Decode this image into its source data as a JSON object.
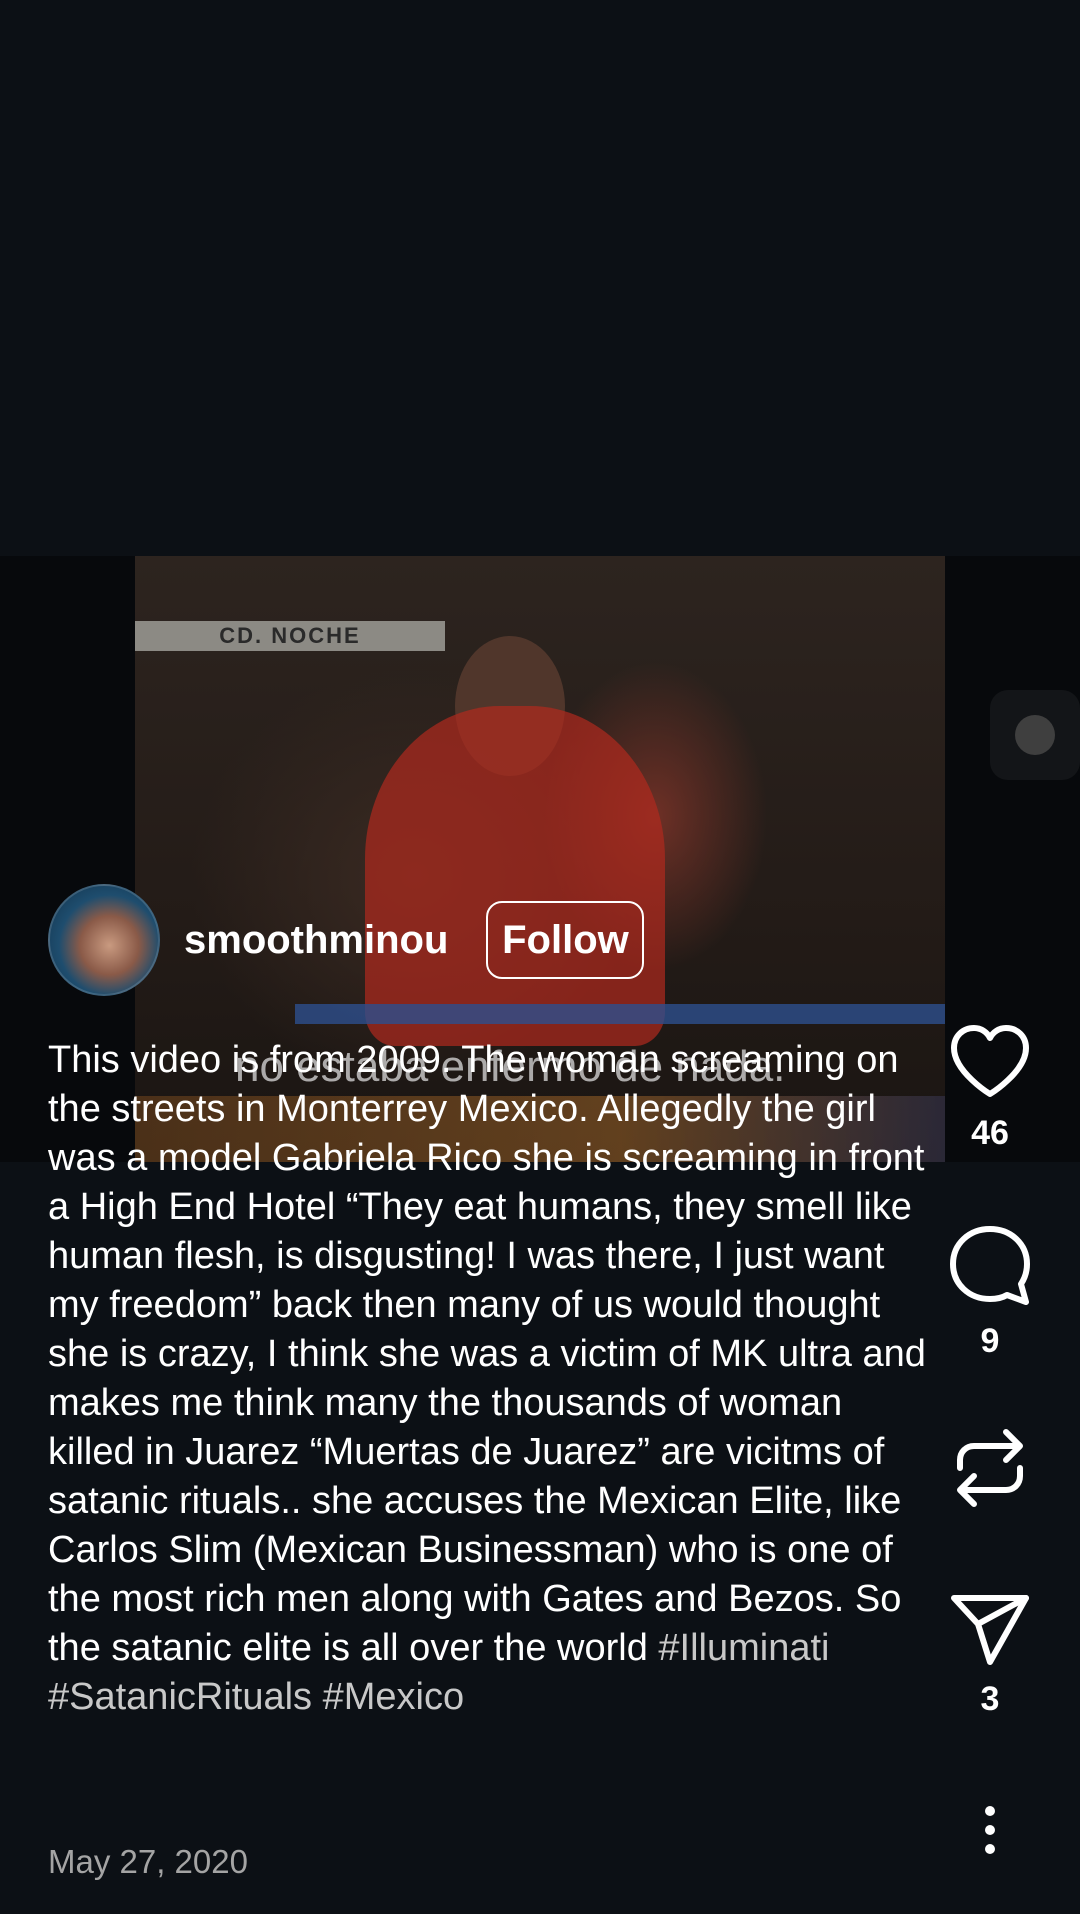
{
  "video": {
    "frame_caption": "CD. NOCHE",
    "frame_subtitle": "no estaba enfermo de nada."
  },
  "author": {
    "username": "smoothminou",
    "follow_label": "Follow"
  },
  "post": {
    "caption_text": "This video is from 2009. The woman screaming on the streets in Monterrey Mexico. Allegedly the girl was a model Gabriela Rico she is screaming in front a High End Hotel “They eat humans, they smell like human flesh, is disgusting! I was there, I just want my freedom” back then many of us would thought she is crazy, I think she was a victim of MK ultra and makes me think many the thousands of woman killed in Juarez “Muertas de Juarez” are vicitms of satanic rituals.. she accuses the Mexican Elite, like Carlos Slim (Mexican Businessman) who is one of the most rich men along with Gates and Bezos. So the satanic elite is all over the world",
    "hashtags": [
      "#Illuminati",
      "#SatanicRituals",
      "#Mexico"
    ],
    "date": "May 27, 2020"
  },
  "actions": {
    "like_count": "46",
    "comment_count": "9",
    "share_count": "3"
  },
  "icons": {
    "like": "heart-icon",
    "comment": "comment-bubble-icon",
    "repost": "repost-icon",
    "share": "send-icon",
    "more": "more-vertical-icon"
  },
  "colors": {
    "background": "#0c1015",
    "text": "#ffffff",
    "hashtag": "#c8c8c8",
    "date": "#a4a4a4"
  }
}
